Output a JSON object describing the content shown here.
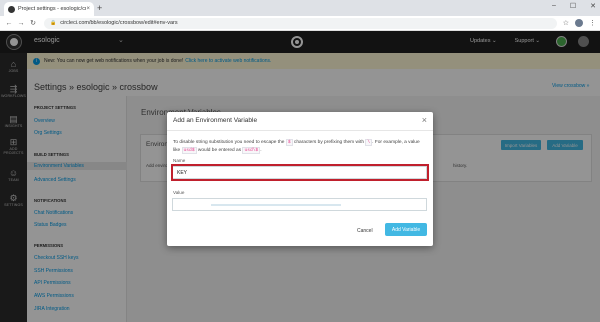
{
  "browser": {
    "tab_title": "Project settings - esologic/crossbow",
    "tab_close": "×",
    "new_tab": "+",
    "url": "circleci.com/bb/esologic/crossbow/edit#env-vars",
    "back": "←",
    "forward": "→",
    "reload": "↻",
    "star": "☆",
    "menu": "⋮",
    "minimize": "–",
    "maximize": "☐",
    "close": "✕"
  },
  "appbar": {
    "org": "esologic",
    "org_chevron": "⌄",
    "updates": "Updates ⌄",
    "support": "Support ⌄"
  },
  "sidebar": [
    {
      "icon": "home-icon",
      "glyph": "⌂",
      "label": "JOBS"
    },
    {
      "icon": "workflows-icon",
      "glyph": "⇶",
      "label": "WORKFLOWS"
    },
    {
      "icon": "insights-icon",
      "glyph": "▤",
      "label": "INSIGHTS"
    },
    {
      "icon": "add-projects-icon",
      "glyph": "⊞",
      "label": "ADD PROJECTS"
    },
    {
      "icon": "team-icon",
      "glyph": "☺",
      "label": "TEAM"
    },
    {
      "icon": "settings-icon",
      "glyph": "⚙",
      "label": "SETTINGS"
    }
  ],
  "banner": {
    "text": "New: You can now get web notifications when your job is done!",
    "link": "Click here to activate web notifications."
  },
  "page": {
    "breadcrumb": "Settings » esologic » crossbow",
    "view_project": "View crossbow »"
  },
  "settings_nav": {
    "project_settings_header": "PROJECT SETTINGS",
    "overview": "Overview",
    "org_settings": "Org Settings",
    "build_settings_header": "BUILD SETTINGS",
    "env_vars": "Environment Variables",
    "advanced": "Advanced Settings",
    "notifications_header": "NOTIFICATIONS",
    "chat": "Chat Notifications",
    "status_badges": "Status Badges",
    "permissions_header": "PERMISSIONS",
    "checkout_ssh": "Checkout SSH keys",
    "ssh_perm": "SSH Permissions",
    "api_perm": "API Permissions",
    "aws_perm": "AWS Permissions",
    "jira": "JIRA Integration"
  },
  "content": {
    "title": "Environment Variables",
    "card_title": "Environment Variables",
    "card_text": "Add environment variables to the job.",
    "card_tail": "history.",
    "import_button": "Import Variables",
    "add_button": "Add Variable"
  },
  "modal": {
    "title": "Add an Environment Variable",
    "close": "×",
    "help_1": "To disable string substitution you need to escape the",
    "help_code_1": "$",
    "help_2": "characters by prefixing them with",
    "help_code_2": "\\",
    "help_3": ". For example,",
    "help_4": "a value like",
    "help_code_3": "usd$",
    "help_5": "would be entered as",
    "help_code_4": "usd\\$",
    "help_6": ".",
    "name_label": "Name",
    "name_value": "KEY",
    "value_label": "Value",
    "cancel": "Cancel",
    "submit": "Add Variable"
  }
}
